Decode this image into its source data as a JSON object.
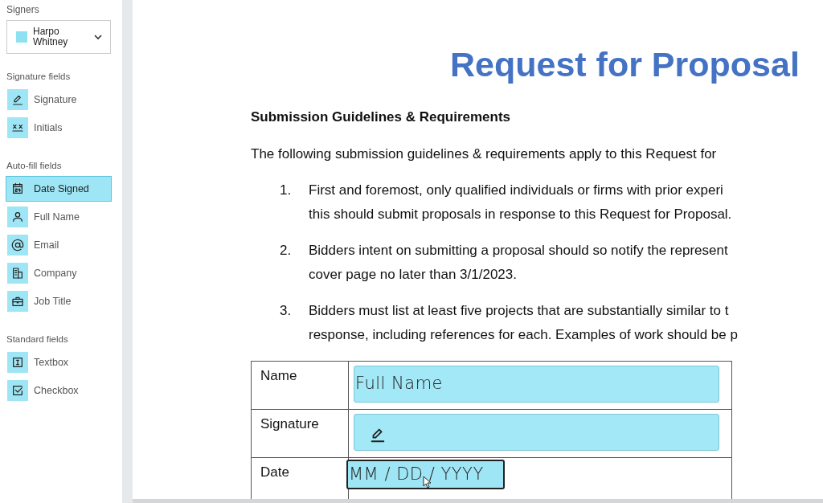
{
  "sidebar": {
    "signers_label": "Signers",
    "signer": {
      "name": "Harpo Whitney",
      "color": "#8fe1f2"
    },
    "sections": [
      {
        "title": "Signature fields",
        "items": [
          {
            "kind": "signature",
            "label": "Signature",
            "selected": false
          },
          {
            "kind": "initials",
            "label": "Initials",
            "selected": false
          }
        ]
      },
      {
        "title": "Auto-fill fields",
        "items": [
          {
            "kind": "date",
            "label": "Date Signed",
            "selected": true
          },
          {
            "kind": "person",
            "label": "Full Name",
            "selected": false
          },
          {
            "kind": "email",
            "label": "Email",
            "selected": false
          },
          {
            "kind": "company",
            "label": "Company",
            "selected": false
          },
          {
            "kind": "jobtitle",
            "label": "Job Title",
            "selected": false
          }
        ]
      },
      {
        "title": "Standard fields",
        "items": [
          {
            "kind": "textbox",
            "label": "Textbox",
            "selected": false
          },
          {
            "kind": "checkbox",
            "label": "Checkbox",
            "selected": false
          }
        ]
      }
    ]
  },
  "document": {
    "title": "Request for Proposal",
    "heading": "Submission Guidelines & Requirements",
    "intro": "The following submission guidelines & requirements apply to this Request for",
    "list": [
      {
        "number": "1.",
        "lines": [
          "First and foremost, only qualified individuals or firms with prior experi",
          "this should submit proposals in response to this Request for Proposal."
        ]
      },
      {
        "number": "2.",
        "lines": [
          "Bidders intent on submitting a proposal should so notify the represent",
          "cover page no later than 3/1/2023."
        ]
      },
      {
        "number": "3.",
        "lines": [
          "Bidders must list at least five projects that are substantially similar to t",
          "response, including references for each. Examples of work should be p"
        ]
      }
    ],
    "table": [
      {
        "label": "Name",
        "field": {
          "kind": "text",
          "text": "Full Name",
          "selected": false
        }
      },
      {
        "label": "Signature",
        "field": {
          "kind": "signature",
          "selected": false
        }
      },
      {
        "label": "Date",
        "field": {
          "kind": "date",
          "text": "MM / DD / YYYY",
          "selected": true
        }
      }
    ]
  }
}
